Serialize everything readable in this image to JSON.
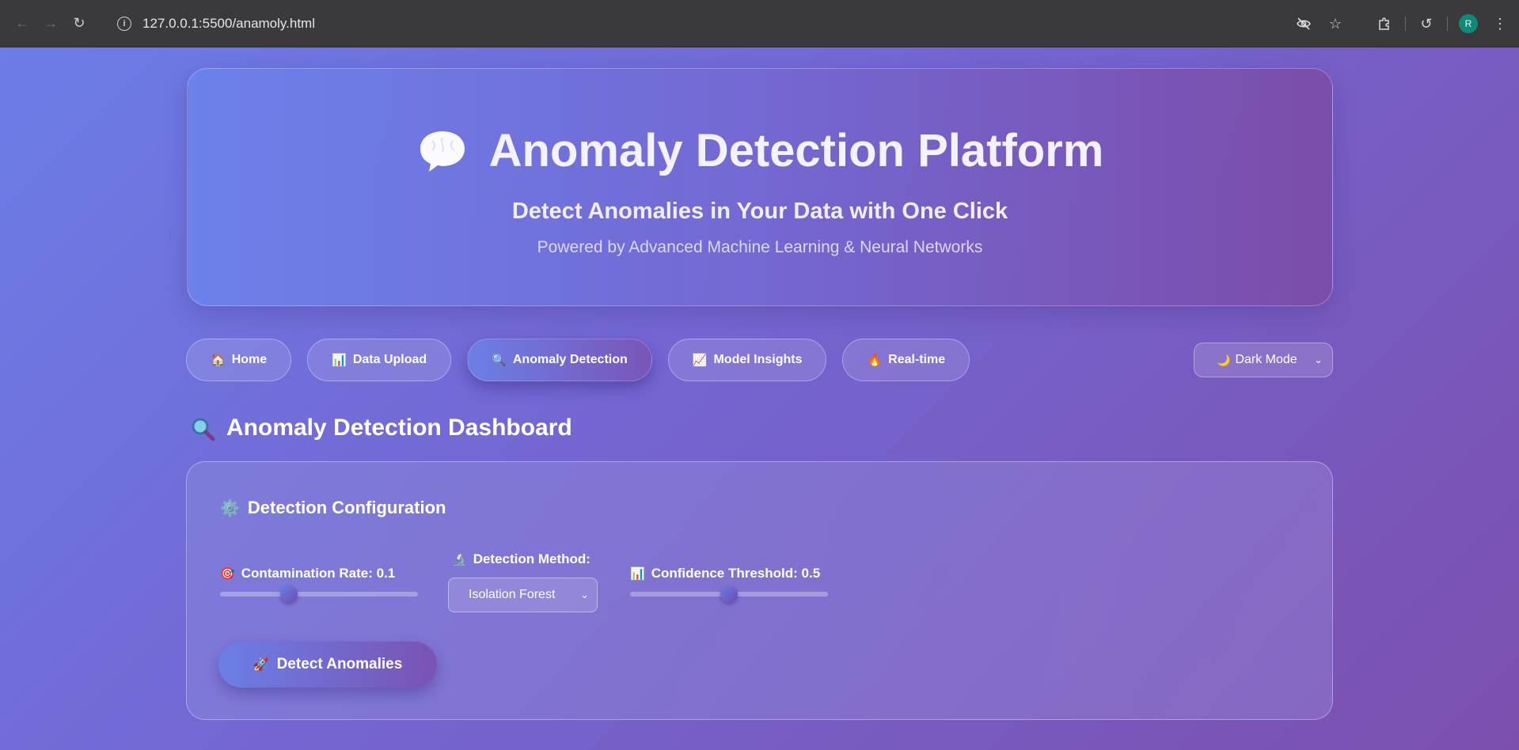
{
  "browser": {
    "url": "127.0.0.1:5500/anamoly.html",
    "profile_initial": "R"
  },
  "hero": {
    "title": "Anomaly Detection Platform",
    "subtitle": "Detect Anomalies in Your Data with One Click",
    "tagline": "Powered by Advanced Machine Learning & Neural Networks"
  },
  "nav": {
    "tabs": [
      {
        "icon": "🏠",
        "label": "Home"
      },
      {
        "icon": "📊",
        "label": "Data Upload"
      },
      {
        "icon": "🔍",
        "label": "Anomaly Detection"
      },
      {
        "icon": "📈",
        "label": "Model Insights"
      },
      {
        "icon": "🔥",
        "label": "Real-time"
      }
    ],
    "theme_select": {
      "icon": "🌙",
      "value": "Dark Mode"
    }
  },
  "section": {
    "title": "Anomaly Detection Dashboard"
  },
  "config": {
    "title": "Detection Configuration",
    "contamination": {
      "label": "Contamination Rate: 0.1",
      "value": 0.1,
      "min": 0,
      "max": 0.3
    },
    "method": {
      "label": "Detection Method:",
      "value": "Isolation Forest"
    },
    "confidence": {
      "label": "Confidence Threshold: 0.5",
      "value": 0.5,
      "min": 0,
      "max": 1
    },
    "detect_button": "Detect Anomalies"
  },
  "colors": {
    "accent_start": "#6b7fe6",
    "accent_end": "#7a52b4",
    "avatar": "#0f8a78"
  }
}
